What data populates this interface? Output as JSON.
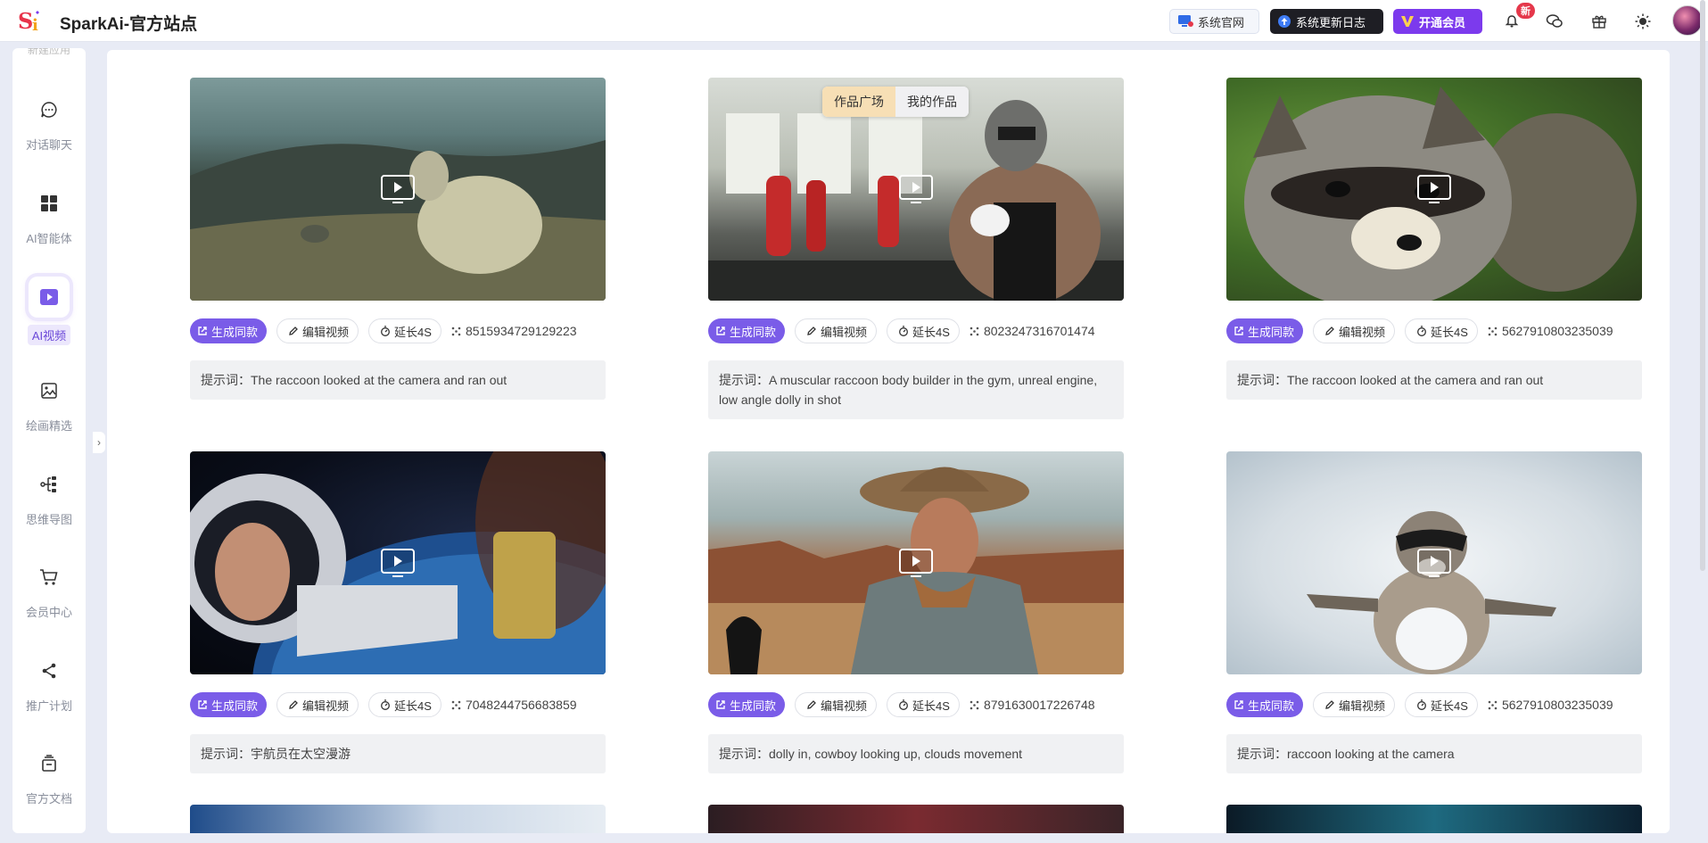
{
  "header": {
    "app_title": "SparkAi-官方站点",
    "official_site": "系统官网",
    "changelog": "系统更新日志",
    "vip": "开通会员",
    "badge": "新"
  },
  "sidebar": {
    "top_partial": "新建应用",
    "items": [
      {
        "label": "对话聊天",
        "icon": "chat-icon"
      },
      {
        "label": "AI智能体",
        "icon": "apps-grid-icon"
      },
      {
        "label": "AI视频",
        "icon": "video-play-icon"
      },
      {
        "label": "绘画精选",
        "icon": "image-icon"
      },
      {
        "label": "思维导图",
        "icon": "mindmap-icon"
      },
      {
        "label": "会员中心",
        "icon": "cart-icon"
      },
      {
        "label": "推广计划",
        "icon": "share-icon"
      },
      {
        "label": "官方文档",
        "icon": "docs-icon"
      }
    ]
  },
  "tabs": {
    "plaza": "作品广场",
    "mine": "我的作品"
  },
  "cards": [
    {
      "gen": "生成同款",
      "edit": "编辑视频",
      "extend": "延长4S",
      "seed": "8515934729129223",
      "prompt": "提示词：The raccoon looked at the camera and ran out"
    },
    {
      "gen": "生成同款",
      "edit": "编辑视频",
      "extend": "延长4S",
      "seed": "8023247316701474",
      "prompt": "提示词：A muscular raccoon body builder in the gym, unreal engine, low angle dolly in shot"
    },
    {
      "gen": "生成同款",
      "edit": "编辑视频",
      "extend": "延长4S",
      "seed": "5627910803235039",
      "prompt": "提示词：The raccoon looked at the camera and ran out"
    },
    {
      "gen": "生成同款",
      "edit": "编辑视频",
      "extend": "延长4S",
      "seed": "7048244756683859",
      "prompt": "提示词：宇航员在太空漫游"
    },
    {
      "gen": "生成同款",
      "edit": "编辑视频",
      "extend": "延长4S",
      "seed": "8791630017226748",
      "prompt": "提示词：dolly in, cowboy looking up, clouds movement"
    },
    {
      "gen": "生成同款",
      "edit": "编辑视频",
      "extend": "延长4S",
      "seed": "5627910803235039",
      "prompt": "提示词：raccoon looking at the camera"
    }
  ],
  "colors": {
    "accent": "#7a5ce8",
    "vip": "#7c3aed",
    "tab_active": "#f7dfb5"
  }
}
